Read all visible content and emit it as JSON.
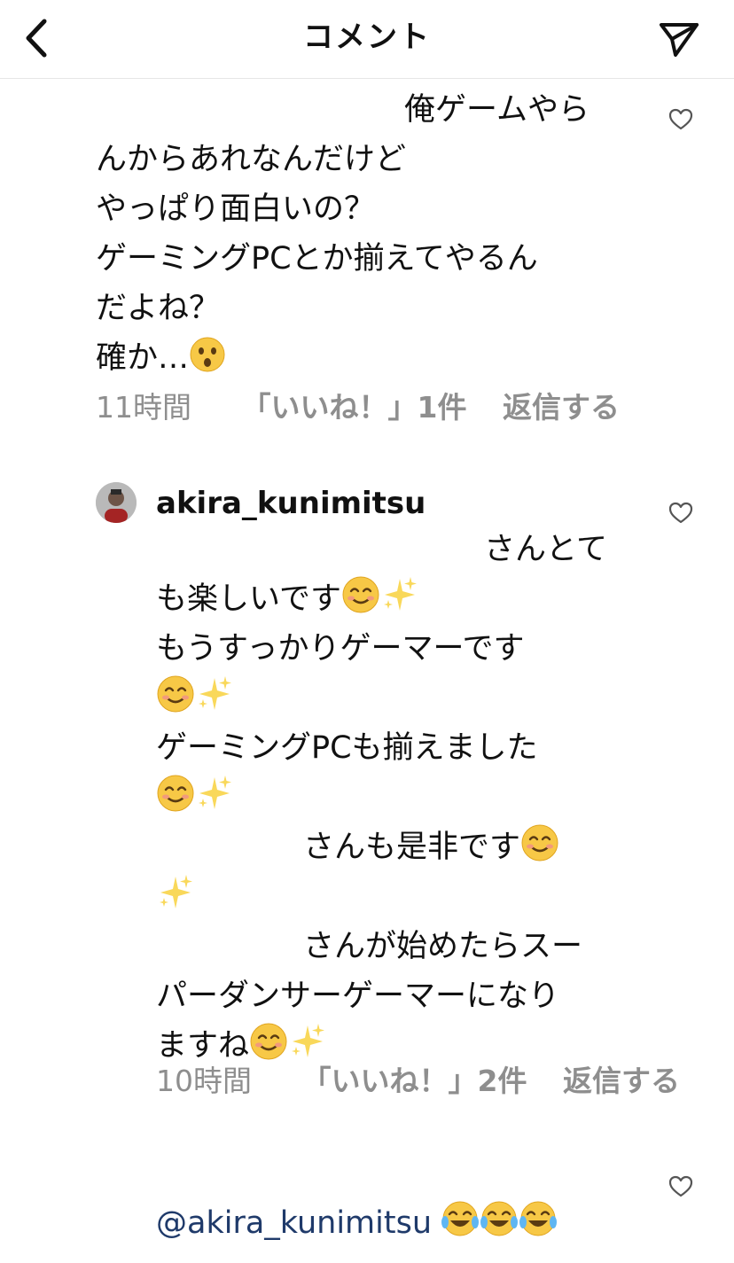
{
  "header": {
    "title": "コメント"
  },
  "comments": [
    {
      "lines": [
        "俺ゲームやら",
        "んからあれなんだけど",
        "やっぱり面白いの？",
        "ゲーミングPCとか揃えてやるん",
        "だよね？",
        "確か…"
      ],
      "meta": {
        "time": "11時間",
        "likes": "「いいね！」1件",
        "reply": "返信する"
      }
    },
    {
      "username": "akira_kunimitsu",
      "lines": [
        "さんとて",
        "も楽しいです",
        "もうすっかりゲーマーです",
        "",
        "ゲーミングPCも揃えました",
        "",
        "さんも是非です",
        "",
        "さんが始めたらスー",
        "パーダンサーゲーマーになり",
        "ますね"
      ],
      "meta": {
        "time": "10時間",
        "likes": "「いいね！」2件",
        "reply": "返信する"
      }
    },
    {
      "mention": "@akira_kunimitsu"
    }
  ],
  "icons": {
    "back": "chevron-left-icon",
    "share": "paper-plane-icon",
    "like": "heart-outline-icon",
    "emoji_surprised": "hushed-face-emoji",
    "emoji_smile": "smiling-face-emoji",
    "emoji_sparkles": "sparkles-emoji",
    "emoji_laugh": "tears-of-joy-emoji"
  },
  "colors": {
    "meta_text": "#8e8e8e",
    "mention": "#1f3a6a",
    "divider": "#e6e6e6"
  }
}
